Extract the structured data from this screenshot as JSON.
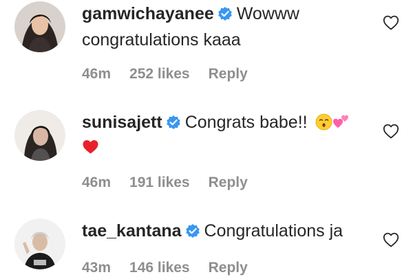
{
  "comments": [
    {
      "username": "gamwichayanee",
      "verified": true,
      "text_line1": "Wowww",
      "text_line2": "congratulations kaaa",
      "time": "46m",
      "likes": "252 likes",
      "reply": "Reply",
      "avatar": "profile-photo"
    },
    {
      "username": "sunisajett",
      "verified": true,
      "text_line1": "Congrats babe!!",
      "emojis_line1": [
        "kissing-face-emoji",
        "two-hearts-emoji"
      ],
      "emojis_line2": [
        "red-heart-emoji"
      ],
      "time": "46m",
      "likes": "191 likes",
      "reply": "Reply",
      "avatar": "profile-photo"
    },
    {
      "username": "tae_kantana",
      "verified": true,
      "text_line1": "Congratulations ja",
      "time": "43m",
      "likes": "146 likes",
      "reply": "Reply",
      "avatar": "profile-photo"
    }
  ],
  "colors": {
    "text": "#262626",
    "muted": "#8e8e8e",
    "verified_badge": "#3897f0",
    "background": "#ffffff"
  },
  "icons": {
    "like": "heart-outline-icon",
    "verified": "verified-badge-icon"
  }
}
